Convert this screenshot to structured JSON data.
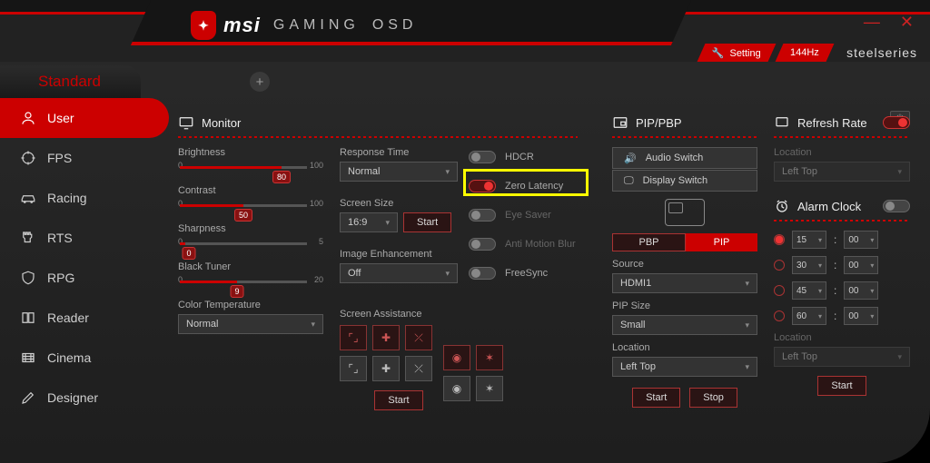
{
  "brand": {
    "msi": "msi",
    "gaming": "GAMING",
    "osd": "OSD"
  },
  "header": {
    "setting": "Setting",
    "refresh": "144Hz",
    "partner": "steelseries"
  },
  "tabs": {
    "standard": "Standard"
  },
  "sidebar": {
    "items": [
      {
        "label": "User"
      },
      {
        "label": "FPS"
      },
      {
        "label": "Racing"
      },
      {
        "label": "RTS"
      },
      {
        "label": "RPG"
      },
      {
        "label": "Reader"
      },
      {
        "label": "Cinema"
      },
      {
        "label": "Designer"
      }
    ]
  },
  "monitor": {
    "title": "Monitor",
    "brightness": {
      "label": "Brightness",
      "value": 80,
      "min": 0,
      "max": 100
    },
    "contrast": {
      "label": "Contrast",
      "value": 50,
      "min": 0,
      "max": 100
    },
    "sharpness": {
      "label": "Sharpness",
      "value": 0,
      "min": 0,
      "max": 5
    },
    "blacktuner": {
      "label": "Black Tuner",
      "value": 9,
      "min": 0,
      "max": 20
    },
    "colortemp": {
      "label": "Color Temperature",
      "value": "Normal"
    }
  },
  "monitor2": {
    "response": {
      "label": "Response Time",
      "value": "Normal"
    },
    "screensize": {
      "label": "Screen Size",
      "value": "16:9",
      "start": "Start"
    },
    "enhance": {
      "label": "Image Enhancement",
      "value": "Off"
    },
    "assist": {
      "title": "Screen Assistance",
      "start": "Start"
    }
  },
  "toggles": {
    "hdcr": {
      "label": "HDCR",
      "on": false,
      "disabled": false
    },
    "zerolat": {
      "label": "Zero Latency",
      "on": true
    },
    "eyesaver": {
      "label": "Eye Saver",
      "on": false,
      "disabled": true
    },
    "antimotion": {
      "label": "Anti Motion Blur",
      "on": false,
      "disabled": true
    },
    "freesync": {
      "label": "FreeSync",
      "on": false
    }
  },
  "pip": {
    "title": "PIP/PBP",
    "audio": "Audio Switch",
    "display": "Display Switch",
    "pbp": "PBP",
    "pipm": "PIP",
    "source": {
      "label": "Source",
      "value": "HDMI1"
    },
    "size": {
      "label": "PIP Size",
      "value": "Small"
    },
    "location": {
      "label": "Location",
      "value": "Left Top"
    },
    "start": "Start",
    "stop": "Stop"
  },
  "refresh": {
    "title": "Refresh Rate",
    "on": true,
    "location": {
      "label": "Location",
      "value": "Left Top"
    }
  },
  "alarm": {
    "title": "Alarm Clock",
    "on": false,
    "rows": [
      {
        "h": "15",
        "m": "00",
        "on": true
      },
      {
        "h": "30",
        "m": "00",
        "on": false
      },
      {
        "h": "45",
        "m": "00",
        "on": false
      },
      {
        "h": "60",
        "m": "00",
        "on": false
      }
    ],
    "location": {
      "label": "Location",
      "value": "Left Top"
    },
    "start": "Start"
  }
}
